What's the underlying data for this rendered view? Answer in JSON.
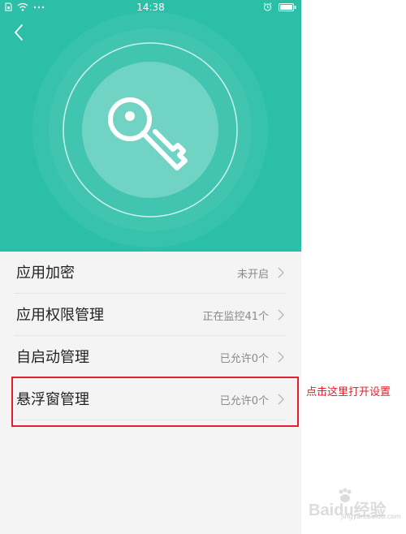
{
  "status_bar": {
    "time": "14:38",
    "icons_left": [
      "sim-icon",
      "wifi-icon",
      "more-dots-icon"
    ],
    "icons_right": [
      "alarm-icon",
      "battery-icon"
    ]
  },
  "header": {
    "accent_color": "#2cbfa8",
    "center_icon": "key-icon"
  },
  "settings_list": [
    {
      "label": "应用加密",
      "value": "未开启"
    },
    {
      "label": "应用权限管理",
      "value": "正在监控41个"
    },
    {
      "label": "自启动管理",
      "value": "已允许0个"
    },
    {
      "label": "悬浮窗管理",
      "value": "已允许0个"
    }
  ],
  "annotation": {
    "text": "点击这里打开设置",
    "color": "#e0202c"
  },
  "watermark": {
    "text": "Baidu经验",
    "sub": "jingyan.baidu.com"
  }
}
